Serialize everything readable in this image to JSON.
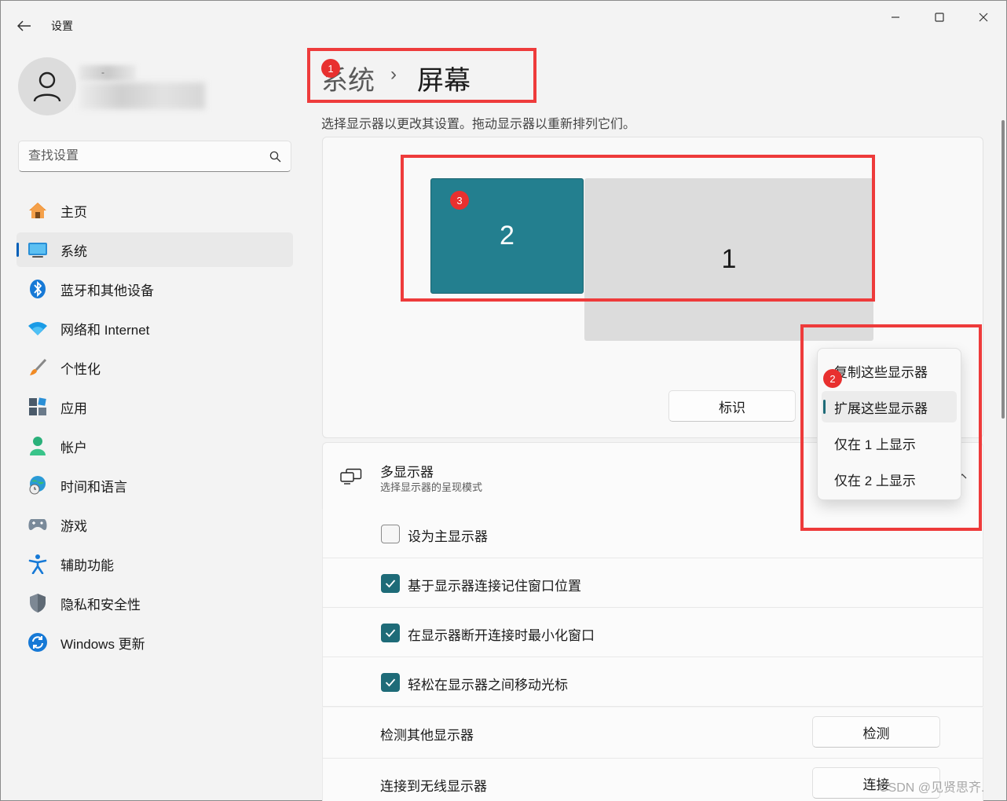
{
  "titlebar": {
    "app_title": "设置",
    "minimize": "—",
    "maximize": "☐",
    "close": "✕"
  },
  "account": {
    "name_fragment": "-"
  },
  "search": {
    "placeholder": "查找设置"
  },
  "sidebar": {
    "items": [
      {
        "label": "主页",
        "icon": "home-icon"
      },
      {
        "label": "系统",
        "icon": "system-icon",
        "active": true
      },
      {
        "label": "蓝牙和其他设备",
        "icon": "bluetooth-icon"
      },
      {
        "label": "网络和 Internet",
        "icon": "wifi-icon"
      },
      {
        "label": "个性化",
        "icon": "brush-icon"
      },
      {
        "label": "应用",
        "icon": "apps-icon"
      },
      {
        "label": "帐户",
        "icon": "account-icon"
      },
      {
        "label": "时间和语言",
        "icon": "globe-clock-icon"
      },
      {
        "label": "游戏",
        "icon": "gamepad-icon"
      },
      {
        "label": "辅助功能",
        "icon": "accessibility-icon"
      },
      {
        "label": "隐私和安全性",
        "icon": "shield-icon"
      },
      {
        "label": "Windows 更新",
        "icon": "update-icon"
      }
    ]
  },
  "breadcrumb": {
    "parent": "系统",
    "separator": "›",
    "current": "屏幕"
  },
  "main": {
    "subtitle": "选择显示器以更改其设置。拖动显示器以重新排列它们。",
    "monitors": {
      "left_label": "2",
      "right_label": "1"
    },
    "identify_label": "标识",
    "multi_display": {
      "title": "多显示器",
      "description": "选择显示器的呈现模式"
    },
    "options": [
      {
        "label": "设为主显示器",
        "checked": false
      },
      {
        "label": "基于显示器连接记住窗口位置",
        "checked": true
      },
      {
        "label": "在显示器断开连接时最小化窗口",
        "checked": true
      },
      {
        "label": "轻松在显示器之间移动光标",
        "checked": true
      }
    ],
    "detect": {
      "label": "检测其他显示器",
      "button": "检测"
    },
    "wireless": {
      "label": "连接到无线显示器",
      "button": "连接"
    }
  },
  "dropdown": {
    "items": [
      {
        "label": "复制这些显示器"
      },
      {
        "label": "扩展这些显示器",
        "selected": true
      },
      {
        "label": "仅在 1 上显示"
      },
      {
        "label": "仅在 2 上显示"
      }
    ]
  },
  "annotations": {
    "marker1": "1",
    "marker2": "2",
    "marker3": "3",
    "color": "#ee3b3b"
  },
  "colors": {
    "accent": "#005fb8",
    "checkbox": "#1e6b78",
    "monitor_selected": "#237f8f",
    "monitor_other": "#dcdcdc"
  },
  "watermark": "CSDN @见贤思齐."
}
